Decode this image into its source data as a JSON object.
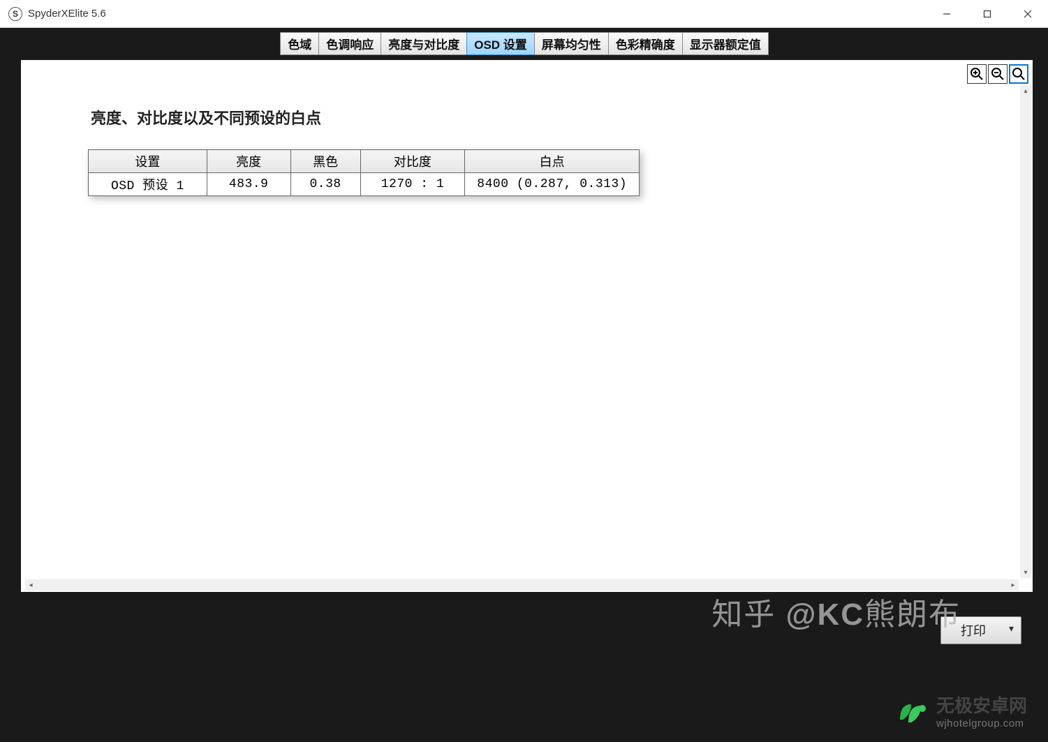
{
  "window": {
    "title": "SpyderXElite 5.6",
    "icon_letter": "S"
  },
  "tabs": [
    {
      "label": "色域",
      "active": false
    },
    {
      "label": "色调响应",
      "active": false
    },
    {
      "label": "亮度与对比度",
      "active": false
    },
    {
      "label": "OSD 设置",
      "active": true
    },
    {
      "label": "屏幕均匀性",
      "active": false
    },
    {
      "label": "色彩精确度",
      "active": false
    },
    {
      "label": "显示器额定值",
      "active": false
    }
  ],
  "document": {
    "heading": "亮度、对比度以及不同预设的白点",
    "columns": [
      "设置",
      "亮度",
      "黑色",
      "对比度",
      "白点"
    ],
    "rows": [
      {
        "c0": "OSD 预设 1",
        "c1": "483.9",
        "c2": "0.38",
        "c3": "1270 : 1",
        "c4": "8400 (0.287, 0.313)"
      }
    ]
  },
  "footer": {
    "print_label": "打印"
  },
  "watermarks": {
    "zhihu": "知乎 @KC熊朗布",
    "brand_cn": "无极安卓网",
    "brand_url": "wjhotelgroup.com"
  }
}
